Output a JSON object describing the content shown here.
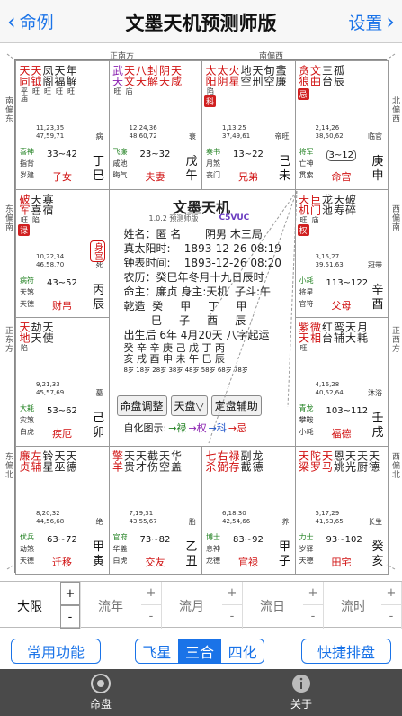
{
  "nav": {
    "back_label": "命例",
    "title": "文墨天机预测师版",
    "settings_label": "设置"
  },
  "directions": {
    "top_left": "正南方",
    "top_right": "南偏西",
    "bottom_left": "北偏东",
    "bottom_right": "正北方",
    "left_1": "南偏东",
    "left_2": "东偏南",
    "left_3": "正东方",
    "left_4": "东偏北",
    "right_1": "西偏南",
    "right_2": "正西方",
    "right_3": "西偏北",
    "right_4": "北偏西"
  },
  "palaces": [
    {
      "id": "si",
      "stars": [
        {
          "n": "天同",
          "b": "平庙",
          "c": "red"
        },
        {
          "n": "天钺",
          "b": "旺",
          "c": "red"
        },
        {
          "n": "凤阁",
          "b": "旺"
        },
        {
          "n": "天福",
          "b": "旺"
        },
        {
          "n": "年解",
          "b": "旺"
        }
      ],
      "ages": "11,23,35\n47,59,71",
      "growth": "病",
      "side": [
        "喜神",
        "指背",
        "岁建"
      ],
      "range": "33~42",
      "palace": "子女",
      "stem": [
        "丁",
        "巳"
      ]
    },
    {
      "id": "wu",
      "stars": [
        {
          "n": "武天",
          "b": "旺",
          "c": "purple"
        },
        {
          "n": "天文",
          "b": "庙",
          "c": "red"
        },
        {
          "n": "八天",
          "b": "",
          "c": "red"
        },
        {
          "n": "封解",
          "b": "",
          "c": "red"
        },
        {
          "n": "阴天",
          "b": "",
          "c": "red"
        },
        {
          "n": "天咸",
          "b": "",
          "c": "red"
        }
      ],
      "ages": "12,24,36\n48,60,72",
      "growth": "衰",
      "side": [
        "飞廉",
        "咸池",
        "晦气"
      ],
      "range": "23~32",
      "palace": "夫妻",
      "stem": [
        "戊",
        "午"
      ]
    },
    {
      "id": "wei",
      "stars": [
        {
          "n": "太阳",
          "b": "陷",
          "c": "red"
        },
        {
          "n": "太阴",
          "b": "",
          "c": "red"
        },
        {
          "n": "火星",
          "b": "",
          "c": "red"
        },
        {
          "n": "地空",
          "b": ""
        },
        {
          "n": "天刑",
          "b": ""
        },
        {
          "n": "旬空",
          "b": ""
        },
        {
          "n": "蜚廉",
          "b": ""
        }
      ],
      "badge": "科",
      "ages": "1,13,25\n37,49,61",
      "growth": "帝旺",
      "side": [
        "奏书",
        "月煞",
        "丧门"
      ],
      "range": "13~22",
      "palace": "兄弟",
      "stem": [
        "己",
        "未"
      ]
    },
    {
      "id": "shen",
      "stars": [
        {
          "n": "贪狼",
          "b": "",
          "c": "red"
        },
        {
          "n": "文曲",
          "b": "",
          "c": "red"
        },
        {
          "n": "三台",
          "b": ""
        },
        {
          "n": "孤辰",
          "b": ""
        }
      ],
      "badge": "忌",
      "ages": "2,14,26\n38,50,62",
      "growth": "临官",
      "side": [
        "将军",
        "亡神",
        "贯索"
      ],
      "range": "3~12",
      "palace": "命宫",
      "stem": [
        "庚",
        "申"
      ]
    },
    {
      "id": "chen",
      "stars": [
        {
          "n": "破军",
          "b": "旺",
          "c": "red"
        },
        {
          "n": "天喜",
          "b": "陷"
        },
        {
          "n": "寡宿",
          "b": ""
        }
      ],
      "badge": "禄",
      "ages": "10,22,34\n46,58,70",
      "growth": "死",
      "side": [
        "病符",
        "天煞",
        "天德"
      ],
      "range": "43~52",
      "palace": "财帛",
      "stem": [
        "丙",
        "辰"
      ],
      "shengong": "身宫"
    },
    {
      "id": "you",
      "stars": [
        {
          "n": "天机",
          "b": "旺",
          "c": "red"
        },
        {
          "n": "巨门",
          "b": "庙",
          "c": "red"
        },
        {
          "n": "龙池",
          "b": ""
        },
        {
          "n": "天寿",
          "b": ""
        },
        {
          "n": "破碎",
          "b": ""
        }
      ],
      "badge": "权",
      "ages": "3,15,27\n39,51,63",
      "growth": "冠带",
      "side": [
        "小耗",
        "将星",
        "官符"
      ],
      "range": "113~122",
      "palace": "父母",
      "stem": [
        "辛",
        "酉"
      ]
    },
    {
      "id": "mao",
      "stars": [
        {
          "n": "天地",
          "b": "陷",
          "c": "red"
        },
        {
          "n": "劫天",
          "b": ""
        },
        {
          "n": "天使",
          "b": ""
        }
      ],
      "ages": "9,21,33\n45,57,69",
      "growth": "墓",
      "side": [
        "大耗",
        "灾煞",
        "白虎"
      ],
      "range": "53~62",
      "palace": "疾厄",
      "stem": [
        "己",
        "卯"
      ]
    },
    {
      "id": "xu",
      "stars": [
        {
          "n": "紫天",
          "b": "旺",
          "c": "red"
        },
        {
          "n": "微相",
          "b": "",
          "c": "red"
        },
        {
          "n": "红台",
          "b": ""
        },
        {
          "n": "鸾辅",
          "b": ""
        },
        {
          "n": "天大",
          "b": ""
        },
        {
          "n": "月耗",
          "b": ""
        }
      ],
      "ages": "4,16,28\n40,52,64",
      "growth": "沐浴",
      "side": [
        "青龙",
        "攀鞍",
        "小耗"
      ],
      "range": "103~112",
      "palace": "福德",
      "stem": [
        "壬",
        "戌"
      ]
    },
    {
      "id": "yin",
      "stars": [
        {
          "n": "廉贞",
          "b": "",
          "c": "red"
        },
        {
          "n": "左辅",
          "b": "",
          "c": "red"
        },
        {
          "n": "铃星",
          "b": ""
        },
        {
          "n": "天巫",
          "b": ""
        },
        {
          "n": "天德",
          "b": ""
        }
      ],
      "ages": "8,20,32\n44,56,68",
      "growth": "绝",
      "side": [
        "伏兵",
        "劫煞",
        "天德"
      ],
      "range": "63~72",
      "palace": "迁移",
      "stem": [
        "甲",
        "寅"
      ]
    },
    {
      "id": "chou",
      "stars": [
        {
          "n": "擎羊",
          "b": "",
          "c": "red"
        },
        {
          "n": "天贵",
          "b": ""
        },
        {
          "n": "天才",
          "b": ""
        },
        {
          "n": "截伤",
          "b": ""
        },
        {
          "n": "天空",
          "b": ""
        },
        {
          "n": "华盖",
          "b": ""
        }
      ],
      "ages": "7,19,31\n43,55,67",
      "growth": "胎",
      "side": [
        "官府",
        "华盖",
        "白虎"
      ],
      "range": "73~82",
      "palace": "交友",
      "stem": [
        "乙",
        "丑"
      ]
    },
    {
      "id": "zi",
      "stars": [
        {
          "n": "七杀",
          "b": "",
          "c": "red"
        },
        {
          "n": "右弼",
          "b": "",
          "c": "red"
        },
        {
          "n": "禄存",
          "b": "",
          "c": "red"
        },
        {
          "n": "副截",
          "b": ""
        },
        {
          "n": "龙德",
          "b": ""
        }
      ],
      "ages": "6,18,30\n42,54,66",
      "growth": "养",
      "side": [
        "博士",
        "息神",
        "龙德"
      ],
      "range": "83~92",
      "palace": "官禄",
      "stem": [
        "甲",
        "子"
      ]
    },
    {
      "id": "hai",
      "stars": [
        {
          "n": "天梁",
          "b": "",
          "c": "red"
        },
        {
          "n": "陀罗",
          "b": "",
          "c": "red"
        },
        {
          "n": "天马",
          "b": "",
          "c": "red"
        },
        {
          "n": "恩姚",
          "b": ""
        },
        {
          "n": "天光",
          "b": ""
        },
        {
          "n": "天厨",
          "b": ""
        },
        {
          "n": "天德",
          "b": ""
        }
      ],
      "ages": "5,17,29\n41,53,65",
      "growth": "长生",
      "side": [
        "力士",
        "岁驿",
        "天德"
      ],
      "range": "93~102",
      "palace": "田宅",
      "stem": [
        "癸",
        "亥"
      ]
    }
  ],
  "center": {
    "title": "文墨天机",
    "version": "1.0.2 预测师版",
    "code": "C5VUC",
    "lines": [
      "姓名：匿 名       阴男 木三局",
      "真太阳时:    1893-12-26 08:19",
      "钟表时间:    1893-12-26 08:20",
      "农历：癸巳年冬月十九日辰时",
      "命主：廉贞 身主:天机  子斗:午",
      "乾造  癸     甲     丁     甲",
      "        巳     子     酉     辰",
      "出生后 6年 4月20天 八字起运"
    ],
    "pillar_stems": "癸 辛 辛 庚 己 戊 丁 丙",
    "pillar_branches": "亥 戌 酉 申 未 午 巳 辰",
    "pillar_ages": "8岁 18岁 28岁 38岁 48岁 58岁 68岁 78岁"
  },
  "buttons": {
    "adjust": "命盘调整",
    "tianpan": "天盘▽",
    "assist": "定盘辅助"
  },
  "legend": {
    "label": "自化图示:",
    "lu": "→禄",
    "quan": "→权",
    "ke": "→科",
    "ji": "→忌"
  },
  "stepper": [
    {
      "label": "大限",
      "plus": "+",
      "minus": "-",
      "active": true
    },
    {
      "label": "流年",
      "plus": "+",
      "minus": "-"
    },
    {
      "label": "流月",
      "plus": "+",
      "minus": "-"
    },
    {
      "label": "流日",
      "plus": "+",
      "minus": "-"
    },
    {
      "label": "流时",
      "plus": "+",
      "minus": "-"
    }
  ],
  "toolbar": {
    "common": "常用功能",
    "seg1": "飞星",
    "seg2": "三合",
    "seg3": "四化",
    "quick": "快捷排盘"
  },
  "tabs": {
    "chart": "命盘",
    "about": "关于"
  },
  "colors": {
    "accent": "#1a73e8",
    "red": "#d01010",
    "tabbar": "#4a4a4a"
  }
}
